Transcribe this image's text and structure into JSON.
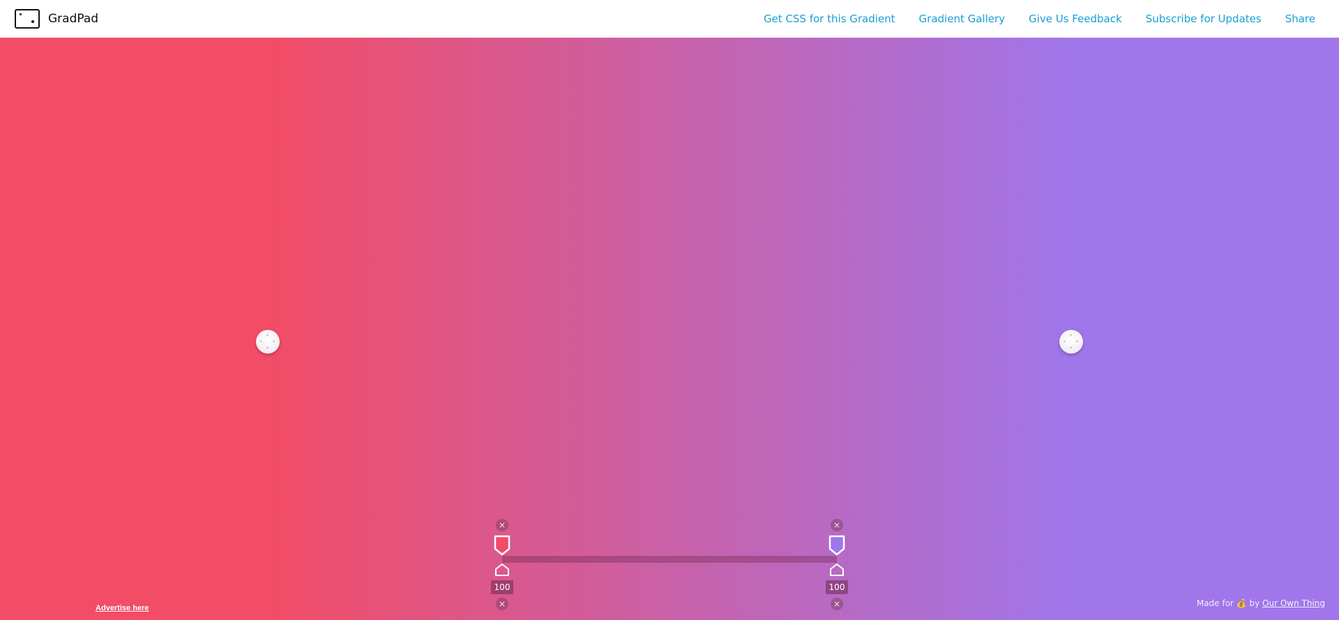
{
  "header": {
    "logo_text": "GradPad",
    "nav": [
      {
        "label": "Get CSS for this Gradient"
      },
      {
        "label": "Gradient Gallery"
      },
      {
        "label": "Give Us Feedback"
      },
      {
        "label": "Subscribe for Updates"
      },
      {
        "label": "Share"
      }
    ]
  },
  "gradient": {
    "direction": "horizontal",
    "start_color": "#f24c66",
    "end_color": "#a076ea",
    "stops": [
      {
        "color": "#f24c66",
        "opacity_label": "100"
      },
      {
        "color": "#a076ea",
        "opacity_label": "100"
      }
    ]
  },
  "accent_color": "#17a0d6",
  "remove_icon": "×",
  "footer": {
    "advertise_label": "Advertise here",
    "made_for": "Made for",
    "emoji": "💰",
    "by": "by",
    "company": "Our Own Thing"
  }
}
